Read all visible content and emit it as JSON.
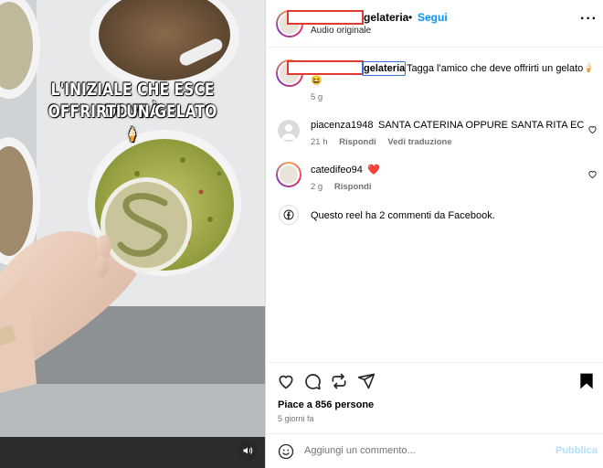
{
  "video": {
    "overlay_line1": "L'INIZIALE CHE ESCE DOVRÀ",
    "overlay_line2": "OFFRIRTI UN GELATO",
    "overlay_emoji": "🍦",
    "mute_icon": "speaker-icon"
  },
  "header": {
    "username": "gelateria",
    "separator": "•",
    "follow_label": "Segui",
    "audio_label": "Audio originale",
    "more_label": "···"
  },
  "caption": {
    "username": "gelateria",
    "text": "Tagga l'amico che deve offrirti un gelato",
    "emoji1": "🍦",
    "emoji2": "😆",
    "time": "5 g"
  },
  "comments": [
    {
      "user": "piacenza1948",
      "text": "SANTA CATERINA OPPURE SANTA RITA EC",
      "time": "21 h",
      "reply": "Rispondi",
      "translate": "Vedi traduzione"
    },
    {
      "user": "catedifeo94",
      "text": "❤️",
      "time": "2 g",
      "reply": "Rispondi"
    }
  ],
  "facebook_note": "Questo reel ha 2 commenti da Facebook.",
  "post": {
    "likes": "Piace a 856 persone",
    "age": "5 giorni fa"
  },
  "comment_box": {
    "placeholder": "Aggiungi un commento...",
    "publish_label": "Pubblica"
  },
  "colors": {
    "accent": "#0095f6",
    "redaction": "#e0392f",
    "heart": "#ed4956",
    "publish_disabled": "#b2dffc"
  }
}
